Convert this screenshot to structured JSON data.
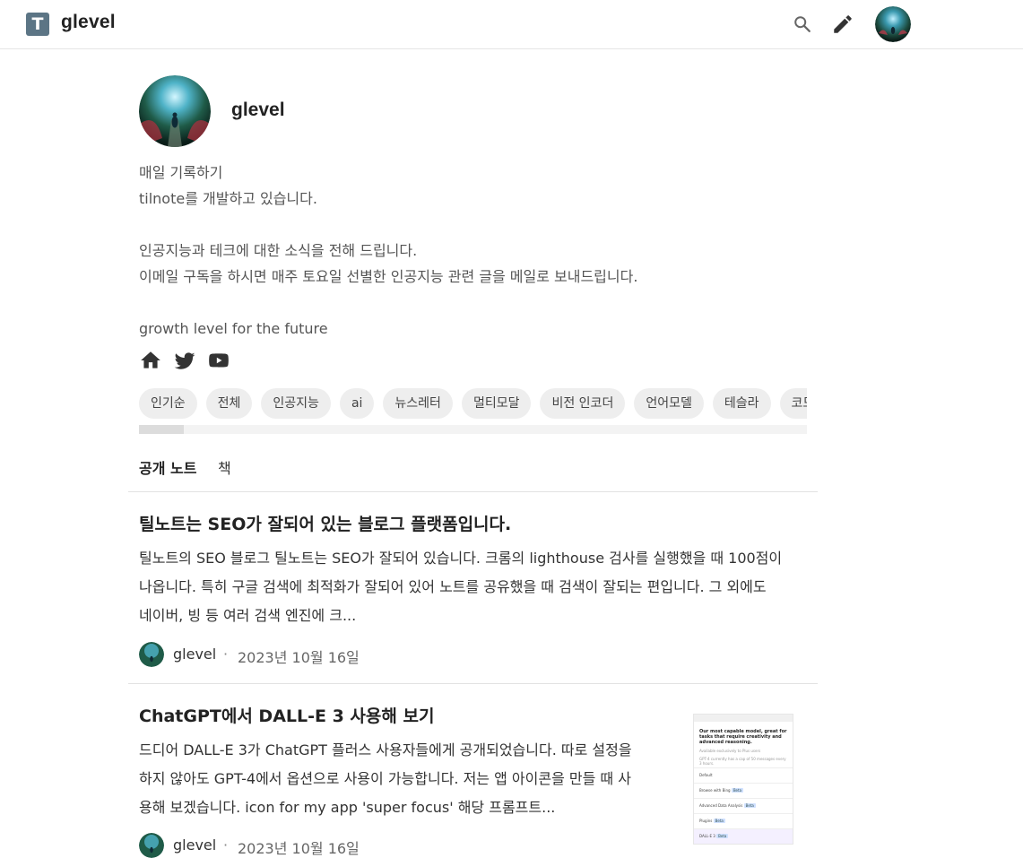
{
  "header": {
    "logo_letter": "T",
    "brand": "glevel"
  },
  "profile": {
    "name": "glevel",
    "bio_lines": [
      "매일 기록하기",
      "tilnote를 개발하고 있습니다.",
      "",
      "인공지능과 테크에 대한 소식을 전해 드립니다.",
      "이메일 구독을 하시면 매주 토요일 선별한 인공지능 관련 글을 메일로 보내드립니다.",
      "",
      "growth level for the future"
    ],
    "social_icons": [
      "home-icon",
      "twitter-icon",
      "youtube-icon"
    ]
  },
  "tags": [
    "인기순",
    "전체",
    "인공지능",
    "ai",
    "뉴스레터",
    "멀티모달",
    "비전 인코더",
    "언어모델",
    "테슬라",
    "코드모델"
  ],
  "tabs": {
    "public_notes": "공개 노트",
    "book": "책"
  },
  "posts": [
    {
      "title": "틸노트는 SEO가 잘되어 있는 블로그 플랫폼입니다.",
      "excerpt_lines": [
        "틸노트의 SEO 블로그 틸노트는 SEO가 잘되어 있습니다. 크롬의 lighthouse 검사를 실행했을 때 100점이",
        "나옵니다. 특히 구글 검색에 최적화가 잘되어 있어 노트를 공유했을 때 검색이 잘되는 편입니다. 그 외에도",
        "네이버, 빙 등 여러 검색 엔진에 크..."
      ],
      "author": "glevel",
      "separator": "·",
      "date": "2023년 10월 16일"
    },
    {
      "title": "ChatGPT에서 DALL-E 3 사용해 보기",
      "excerpt_lines": [
        "드디어 DALL-E 3가 ChatGPT 플러스 사용자들에게 공개되었습니다. 따로 설정을",
        "하지 않아도 GPT-4에서 옵션으로 사용이 가능합니다. 저는 앱 아이콘을 만들 때 사",
        "용해 보겠습니다. icon for my app 'super focus' 해당 프롬프트..."
      ],
      "author": "glevel",
      "separator": "·",
      "date": "2023년 10월 16일",
      "thumbnail": {
        "heading": "Our most capable model, great for tasks that require creativity and advanced reasoning.",
        "sub1": "Available exclusively to Plus users",
        "sub2": "GPT-4 currently has a cap of 50 messages every 3 hours.",
        "options": [
          {
            "label": "Default",
            "badge": ""
          },
          {
            "label": "Browse with  Bing",
            "badge": "Beta"
          },
          {
            "label": "Advanced Data Analysis",
            "badge": "Beta"
          },
          {
            "label": "Plugins",
            "badge": "Beta"
          },
          {
            "label": "DALL·E 3",
            "badge": "Beta"
          }
        ]
      }
    }
  ]
}
